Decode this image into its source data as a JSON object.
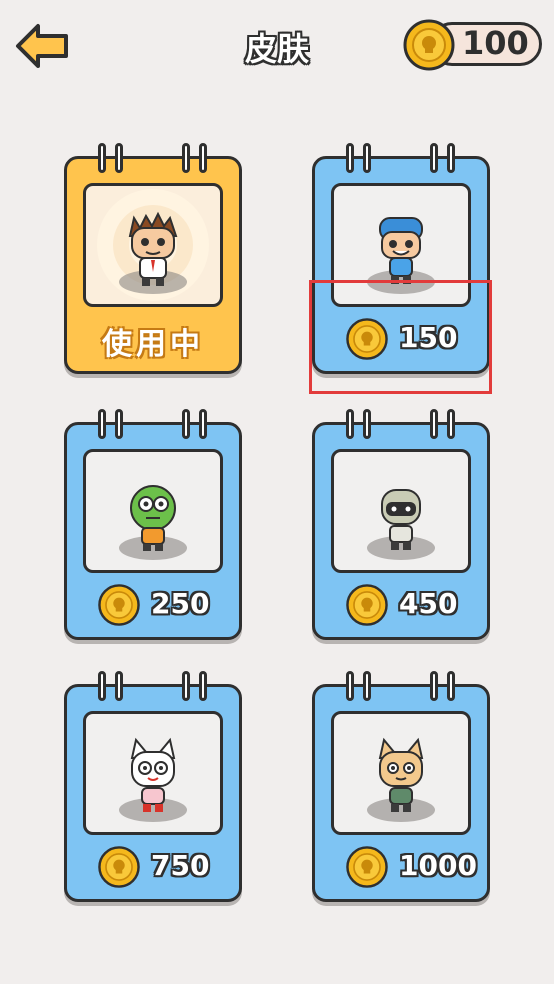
{
  "header": {
    "title": "皮肤",
    "coin_balance": "100"
  },
  "skins": [
    {
      "name": "boy-skin",
      "status": "使用中",
      "price": null,
      "equipped": true
    },
    {
      "name": "blue-helmet-skin",
      "status": null,
      "price": "150",
      "equipped": false
    },
    {
      "name": "zombie-skin",
      "status": null,
      "price": "250",
      "equipped": false
    },
    {
      "name": "robot-skin",
      "status": null,
      "price": "450",
      "equipped": false
    },
    {
      "name": "white-cat-skin",
      "status": null,
      "price": "750",
      "equipped": false
    },
    {
      "name": "tan-cat-skin",
      "status": null,
      "price": "1000",
      "equipped": false
    }
  ],
  "colors": {
    "background": "#f1eeed",
    "card_blue": "#7ec4f3",
    "card_gold": "#ffc44d",
    "coin": "#f5b81c",
    "outline": "#2f2f2f",
    "highlight": "#e23b3b"
  }
}
